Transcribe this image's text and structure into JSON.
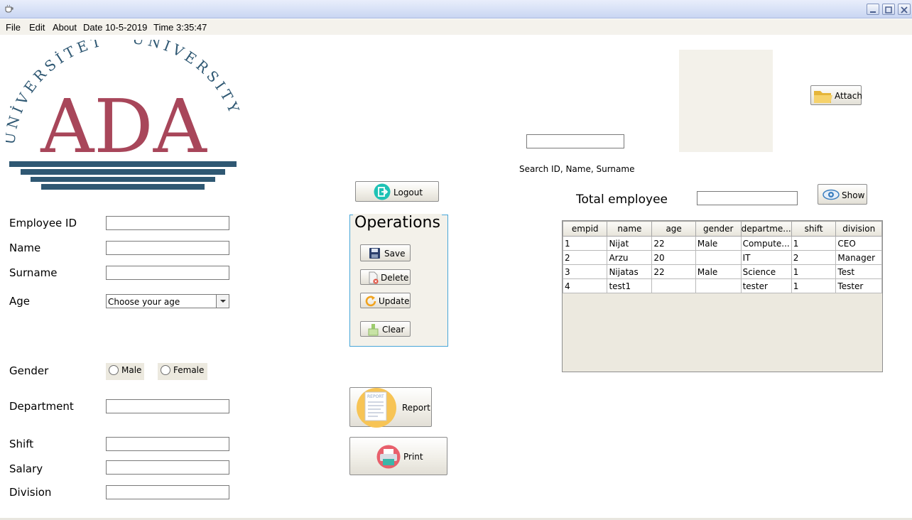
{
  "window": {
    "title": ""
  },
  "menu": {
    "items": [
      "File",
      "Edit",
      "About",
      "Date 10-5-2019",
      "Time 3:35:47"
    ]
  },
  "logo": {
    "arc_text": "UNİVERSİTET ° UNIVERSITY",
    "main_text": "ADA",
    "main_color": "#a8465a",
    "arc_color": "#2f5873",
    "bar_color": "#2f5873"
  },
  "form": {
    "employee_id_label": "Employee ID",
    "name_label": "Name",
    "surname_label": "Surname",
    "age_label": "Age",
    "age_selected": "Choose your age",
    "gender_label": "Gender",
    "gender_male": "Male",
    "gender_female": "Female",
    "department_label": "Department",
    "shift_label": "Shift",
    "salary_label": "Salary",
    "division_label": "Division"
  },
  "buttons": {
    "logout": "Logout",
    "save": "Save",
    "delete": "Delete",
    "update": "Update",
    "clear": "Clear",
    "report": "Report",
    "report_icon_caption": "REPORT",
    "print": "Print",
    "attach": "Attach",
    "show": "Show"
  },
  "operations": {
    "title": "Operations"
  },
  "search": {
    "label": "Search ID, Name, Surname"
  },
  "total": {
    "label": "Total employee"
  },
  "table": {
    "headers": [
      "empid",
      "name",
      "age",
      "gender",
      "departme...",
      "shift",
      "division"
    ],
    "rows": [
      [
        "1",
        "Nijat",
        "22",
        "Male",
        "Compute...",
        "1",
        "CEO"
      ],
      [
        "2",
        "Arzu",
        "20",
        "",
        "IT",
        "2",
        "Manager"
      ],
      [
        "3",
        "Nijatas",
        "22",
        "Male",
        "Science",
        "1",
        "Test"
      ],
      [
        "4",
        "test1",
        "",
        "",
        "tester",
        "1",
        "Tester"
      ]
    ]
  },
  "colors": {
    "titlebar": "#c9d6f2",
    "panel_bg": "#f3f1ea",
    "ops_border": "#48a6d8",
    "logout_icon": "#1ec2b5",
    "report_icon_bg": "#f7c455",
    "print_icon_bg": "#e8606c"
  }
}
